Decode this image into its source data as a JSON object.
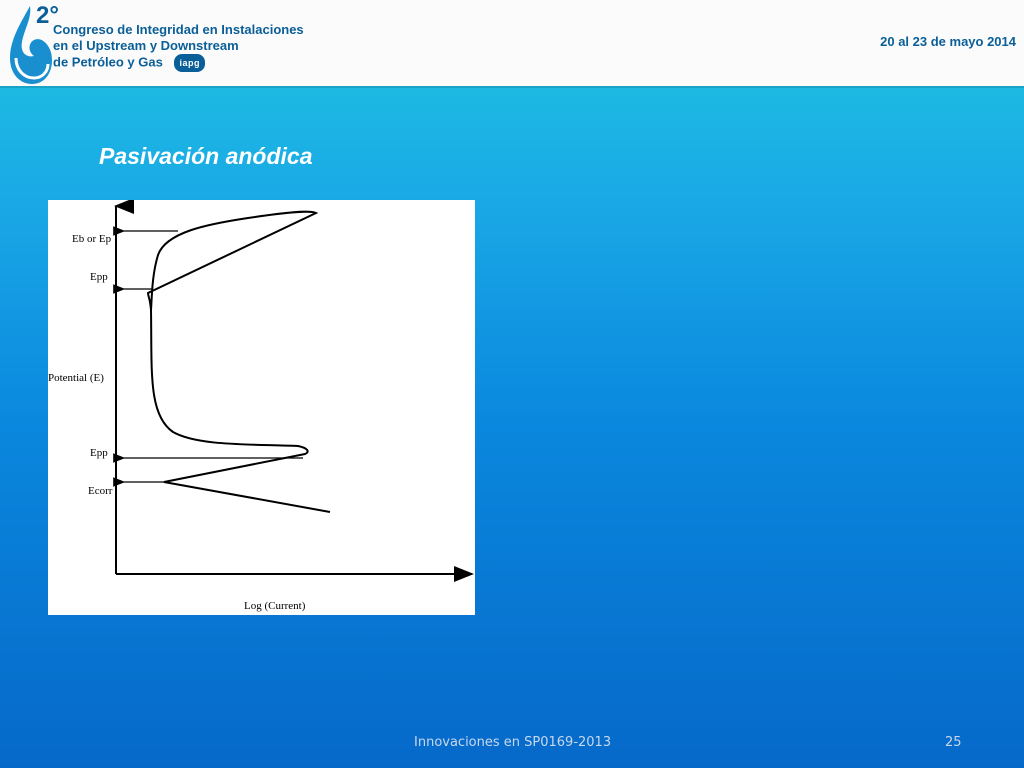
{
  "header": {
    "logo_number": "2°",
    "conference_lines": [
      "Congreso de Integridad en Instalaciones",
      "en el Upstream y Downstream",
      "de Petróleo y Gas"
    ],
    "iapg_badge": "iapg",
    "dates": "20 al 23 de mayo 2014"
  },
  "slide": {
    "title": "Pasivación anódica"
  },
  "figure": {
    "y_axis_label": "Potential (E)",
    "x_axis_label": "Log (Current)",
    "labels": {
      "eb_or_ep": "Eb or Ep",
      "epp_top": "Epp",
      "epp_bottom": "Epp",
      "ecorr": "Ecorr"
    }
  },
  "footer": {
    "text": "Innovaciones en SP0169-2013",
    "page_number": "25"
  },
  "colors": {
    "brand_blue": "#0a5f98",
    "bg_top": "#1fc6e0",
    "bg_bottom": "#0669c9"
  }
}
